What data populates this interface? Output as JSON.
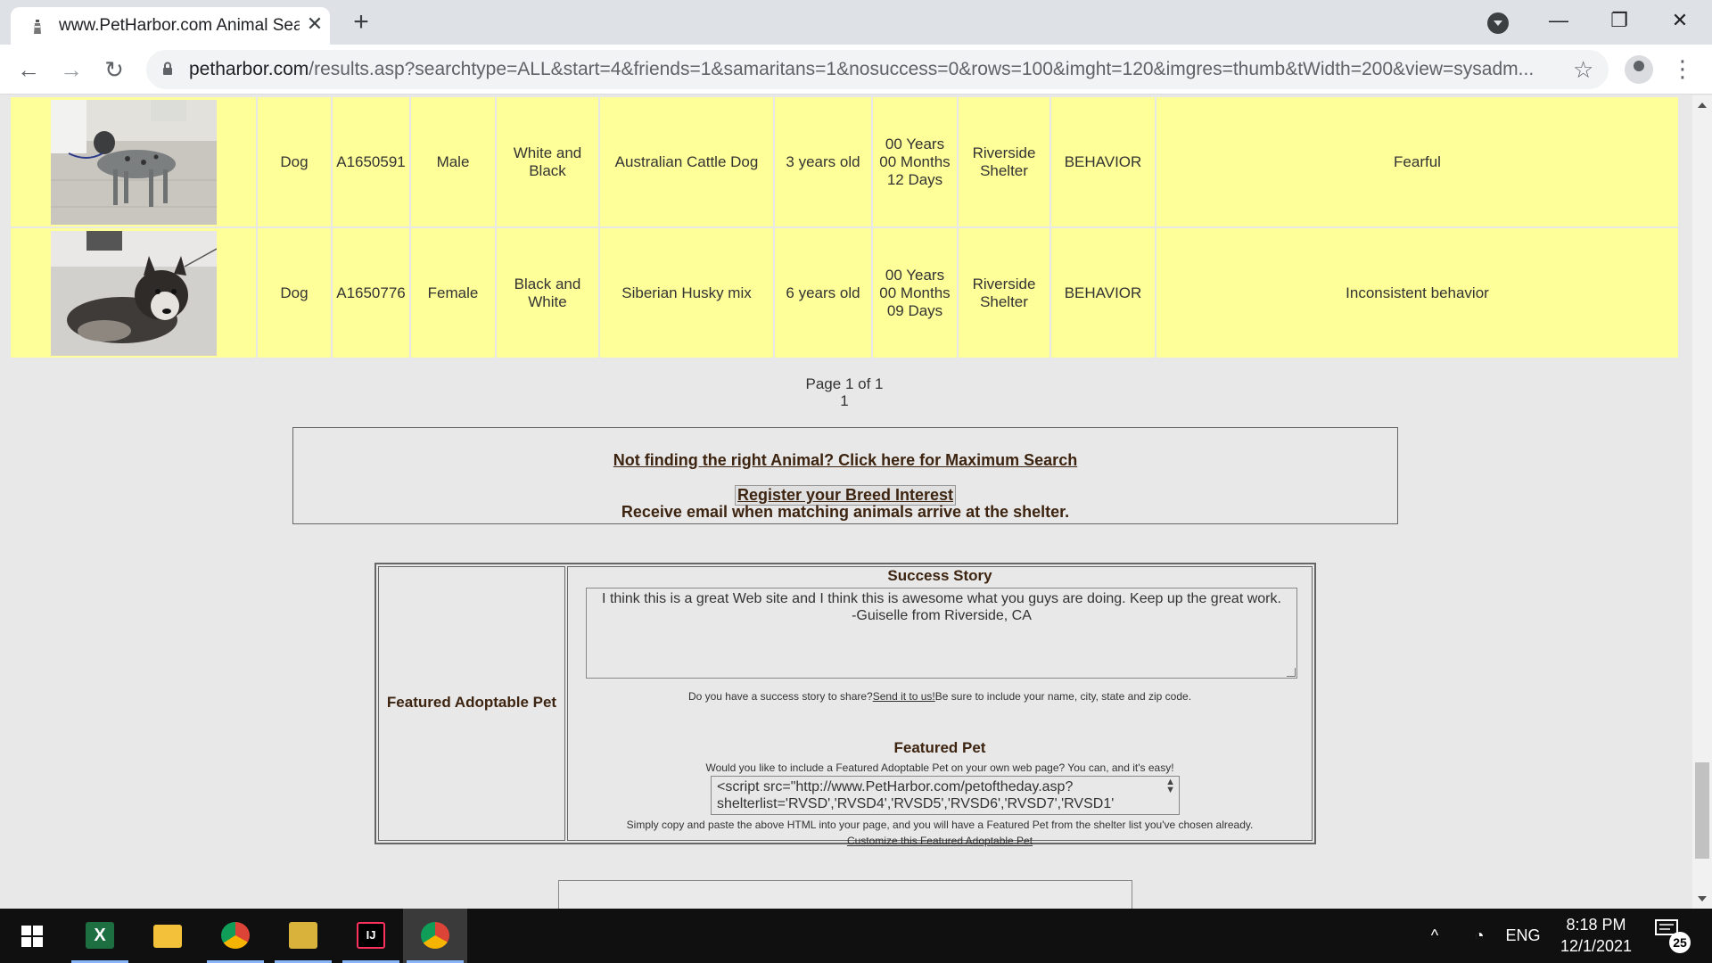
{
  "browser": {
    "tab_title": "www.PetHarbor.com Animal Sear",
    "url_host": "petharbor.com",
    "url_path": "/results.asp?searchtype=ALL&start=4&friends=1&samaritans=1&nosuccess=0&rows=100&imght=120&imgres=thumb&tWidth=200&view=sysadm..."
  },
  "results": [
    {
      "type": "Dog",
      "id": "A1650591",
      "sex": "Male",
      "color_line1": "White and",
      "color_line2": "Black",
      "breed": "Australian Cattle Dog",
      "age": "3 years old",
      "stay_line1": "00 Years",
      "stay_line2": "00 Months",
      "stay_line3": "12 Days",
      "shelter_line1": "Riverside",
      "shelter_line2": "Shelter",
      "reason": "BEHAVIOR",
      "note": "Fearful"
    },
    {
      "type": "Dog",
      "id": "A1650776",
      "sex": "Female",
      "color_line1": "Black and",
      "color_line2": "White",
      "breed": "Siberian Husky mix",
      "age": "6 years old",
      "stay_line1": "00 Years",
      "stay_line2": "00 Months",
      "stay_line3": "09 Days",
      "shelter_line1": "Riverside",
      "shelter_line2": "Shelter",
      "reason": "BEHAVIOR",
      "note": "Inconsistent behavior"
    }
  ],
  "pager": {
    "summary": "Page 1 of 1",
    "page_number": "1"
  },
  "search_box": {
    "max_search_link": "Not finding the right Animal? Click here for Maximum Search",
    "breed_interest_link": "Register your Breed Interest",
    "receive_text": "Receive email when matching animals arrive at the shelter."
  },
  "featured": {
    "left_label": "Featured Adoptable Pet",
    "success_heading": "Success Story",
    "story_text": "I think this is a great Web site and I think this is awesome what you guys are doing. Keep up the great work.",
    "story_author": "-Guiselle from Riverside, CA",
    "share_prefix": "Do you have a success story to share?",
    "share_link": "Send it to us!",
    "share_suffix": "Be sure to include your name, city, state and zip code.",
    "pet_heading": "Featured Pet",
    "pet_desc": "Would you like to include a Featured Adoptable Pet on your own web page? You can, and it's easy!",
    "code_line1": "<script src=\"http://www.PetHarbor.com/petoftheday.asp?",
    "code_line2": "shelterlist='RVSD','RVSD4','RVSD5','RVSD6','RVSD7','RVSD1'",
    "copy_text": "Simply copy and paste the above HTML into your page, and you will have a Featured Pet from the shelter list you've chosen already.",
    "customize_link": "Customize this Featured Adoptable Pet"
  },
  "taskbar": {
    "language": "ENG",
    "time": "8:18 PM",
    "date": "12/1/2021",
    "notification_count": "25"
  },
  "colors": {
    "row_highlight": "#ffff99",
    "link_brown": "#3d2410",
    "page_bg": "#e8e8e8"
  }
}
